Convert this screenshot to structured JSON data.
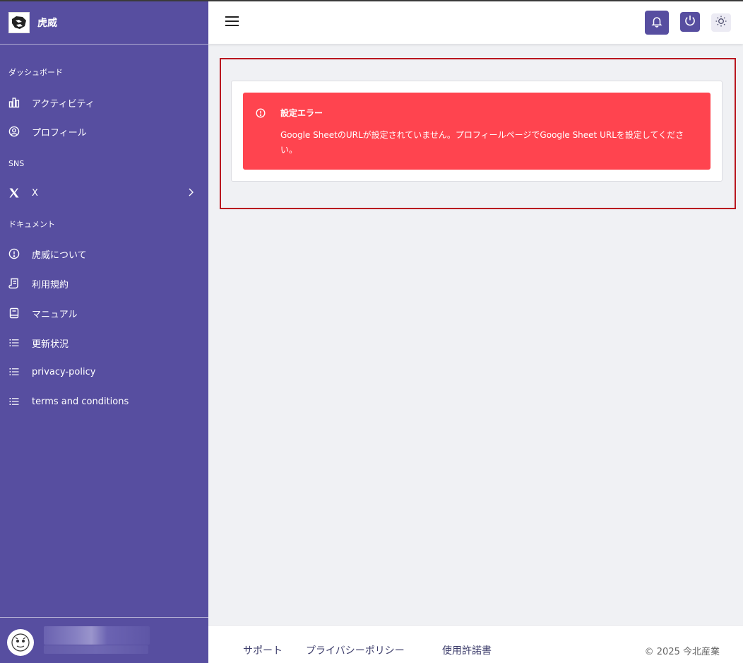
{
  "brand": {
    "name": "虎威",
    "logo_icon": "tiger-logo-icon"
  },
  "sidebar": {
    "sections": [
      {
        "label": "ダッシュボード"
      },
      {
        "label": "SNS"
      },
      {
        "label": "ドキュメント"
      }
    ],
    "items": [
      {
        "label": "アクティビティ",
        "icon": "bar-chart-icon"
      },
      {
        "label": "プロフィール",
        "icon": "user-circle-icon"
      },
      {
        "label": "X",
        "icon": "x-logo-icon"
      },
      {
        "label": "虎威について",
        "icon": "info-circle-icon"
      },
      {
        "label": "利用規約",
        "icon": "document-icon"
      },
      {
        "label": "マニュアル",
        "icon": "book-icon"
      },
      {
        "label": "更新状況",
        "icon": "list-icon"
      },
      {
        "label": "privacy-policy",
        "icon": "list-icon"
      },
      {
        "label": "terms and conditions",
        "icon": "list-icon"
      }
    ]
  },
  "header": {
    "menu_icon": "hamburger-icon",
    "notification_icon": "bell-icon",
    "logout_icon": "power-icon",
    "theme_icon": "sun-icon",
    "colors": {
      "accent": "#574ea0"
    }
  },
  "alert": {
    "title": "設定エラー",
    "message": "Google SheetのURLが設定されていません。プロフィールページでGoogle Sheet URLを設定してください。",
    "color": "#ff444f"
  },
  "footer": {
    "links": [
      {
        "label": "サポート"
      },
      {
        "label": "プライバシーポリシー"
      },
      {
        "label": "使用許諾書"
      }
    ],
    "copyright": "© 2025 今北産業"
  }
}
